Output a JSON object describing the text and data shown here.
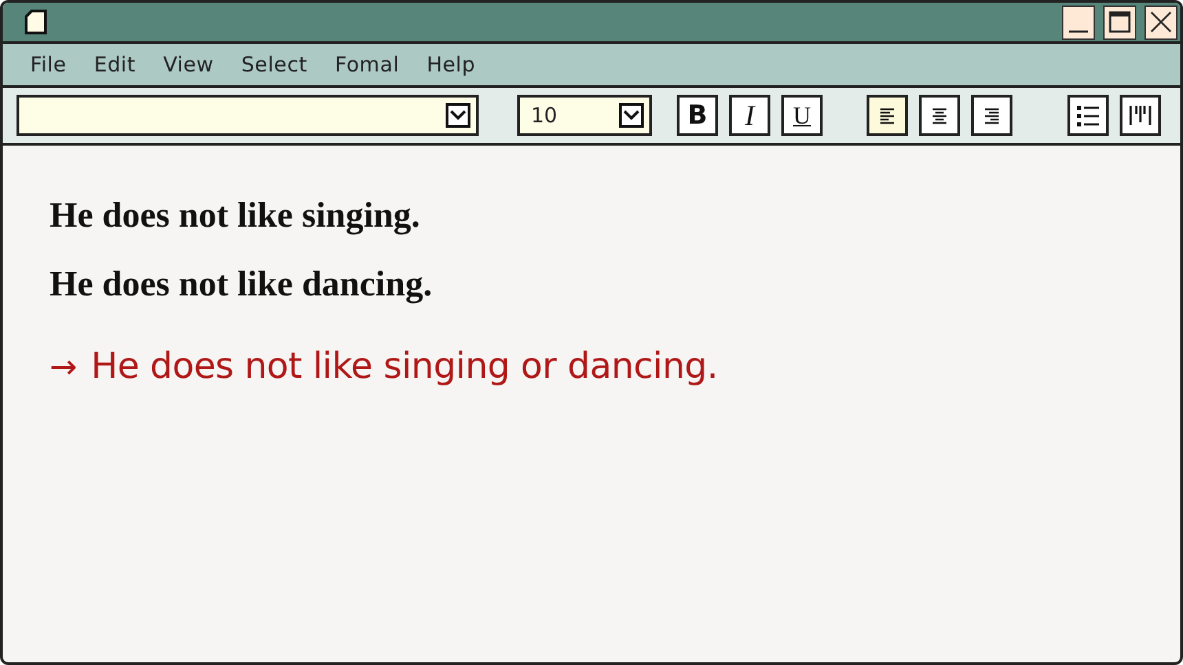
{
  "menu": [
    "File",
    "Edit",
    "View",
    "Select",
    "Fomal",
    "Help"
  ],
  "toolbar": {
    "font_size": "10",
    "format_buttons": [
      "B",
      "I",
      "U"
    ],
    "align_buttons": [
      {
        "kind": "left",
        "selected": true
      },
      {
        "kind": "center",
        "selected": false
      },
      {
        "kind": "right",
        "selected": false
      }
    ],
    "list_buttons": [
      {
        "kind": "bullets"
      },
      {
        "kind": "columns"
      }
    ]
  },
  "lines": [
    {
      "kind": "sentence",
      "text": "He does not like singing."
    },
    {
      "kind": "sentence",
      "text": "He does not like dancing."
    },
    {
      "kind": "result",
      "arrow": "→",
      "text": "He does not like singing or dancing."
    }
  ]
}
